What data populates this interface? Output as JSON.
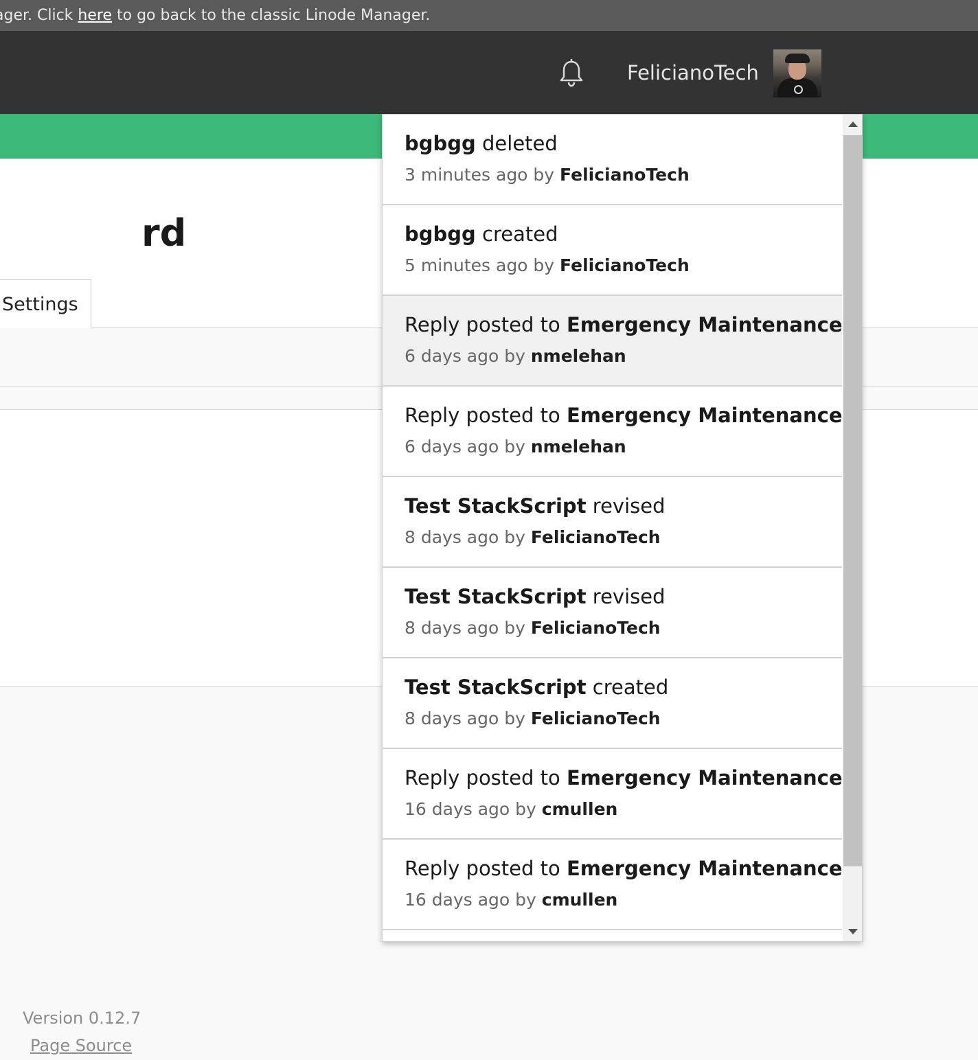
{
  "banner": {
    "prefix": "ager. Click ",
    "link": "here",
    "suffix": " to go back to the classic Linode Manager."
  },
  "header": {
    "bell_icon": "bell-icon",
    "username": "FelicianoTech",
    "avatar_icon": "user-avatar"
  },
  "page": {
    "title_fragment": "rd",
    "tabs": [
      {
        "label": "Settings"
      }
    ]
  },
  "notifications": [
    {
      "subject": "bgbgg",
      "action": " deleted",
      "time": "3 minutes ago by ",
      "user": "FelicianoTech"
    },
    {
      "subject": "bgbgg",
      "action": " created",
      "time": "5 minutes ago by ",
      "user": "FelicianoTech"
    },
    {
      "prefix": "Reply posted to ",
      "subject": "Emergency Maintenance",
      "time": "6 days ago by ",
      "user": "nmelehan"
    },
    {
      "prefix": "Reply posted to ",
      "subject": "Emergency Maintenance",
      "time": "6 days ago by ",
      "user": "nmelehan"
    },
    {
      "subject": "Test StackScript",
      "action": " revised",
      "time": "8 days ago by ",
      "user": "FelicianoTech"
    },
    {
      "subject": "Test StackScript",
      "action": " revised",
      "time": "8 days ago by ",
      "user": "FelicianoTech"
    },
    {
      "subject": "Test StackScript",
      "action": " created",
      "time": "8 days ago by ",
      "user": "FelicianoTech"
    },
    {
      "prefix": "Reply posted to ",
      "subject": "Emergency Maintenance",
      "time": "16 days ago by ",
      "user": "cmullen"
    },
    {
      "prefix": "Reply posted to ",
      "subject": "Emergency Maintenance",
      "time": "16 days ago by ",
      "user": "cmullen"
    }
  ],
  "footer": {
    "version": "Version 0.12.7",
    "source_link": "Page Source"
  },
  "colors": {
    "brand_green": "#3cb878",
    "header_bg": "#333333",
    "banner_bg": "#5a5a5a"
  }
}
